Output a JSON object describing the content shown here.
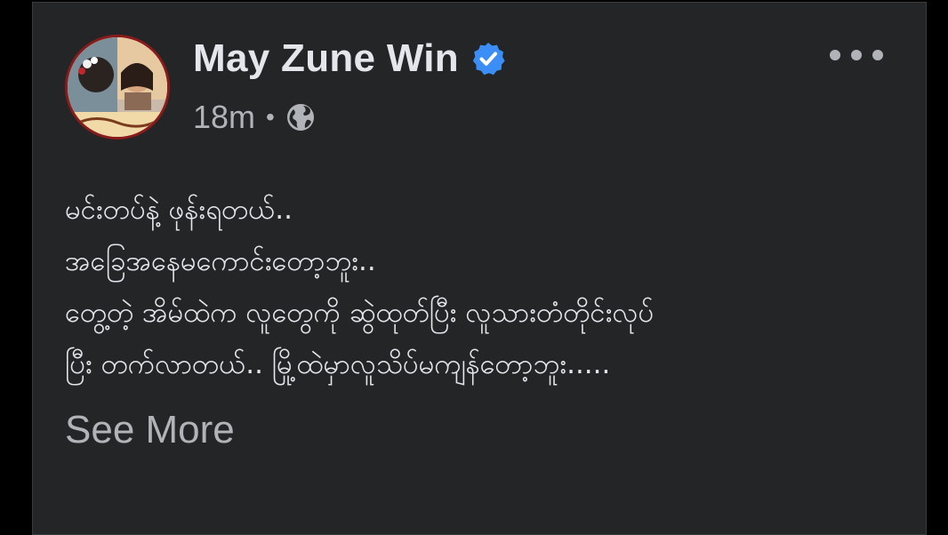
{
  "post": {
    "author": "May Zune Win",
    "time": "18m",
    "separator": "•",
    "lines": [
      "မင်းတပ်နဲ့ ဖုန်းရတယ်..",
      "အခြေအနေမကောင်းတော့ဘူး..",
      "တွေ့တဲ့ အိမ်ထဲက လူတွေကို ဆွဲထုတ်ပြီး လူသားတံတိုင်းလုပ်",
      "ပြီး တက်လာတယ်.. မြို့ထဲမှာလူသိပ်မကျန်တော့ဘူး....."
    ],
    "see_more_label": "See More",
    "icons": {
      "verified": "verified-badge-icon",
      "privacy": "globe-icon",
      "menu": "more-options-icon"
    },
    "colors": {
      "card_background": "#242526",
      "verified_blue": "#3a8ef5",
      "secondary_text": "#b0b3b8"
    }
  }
}
